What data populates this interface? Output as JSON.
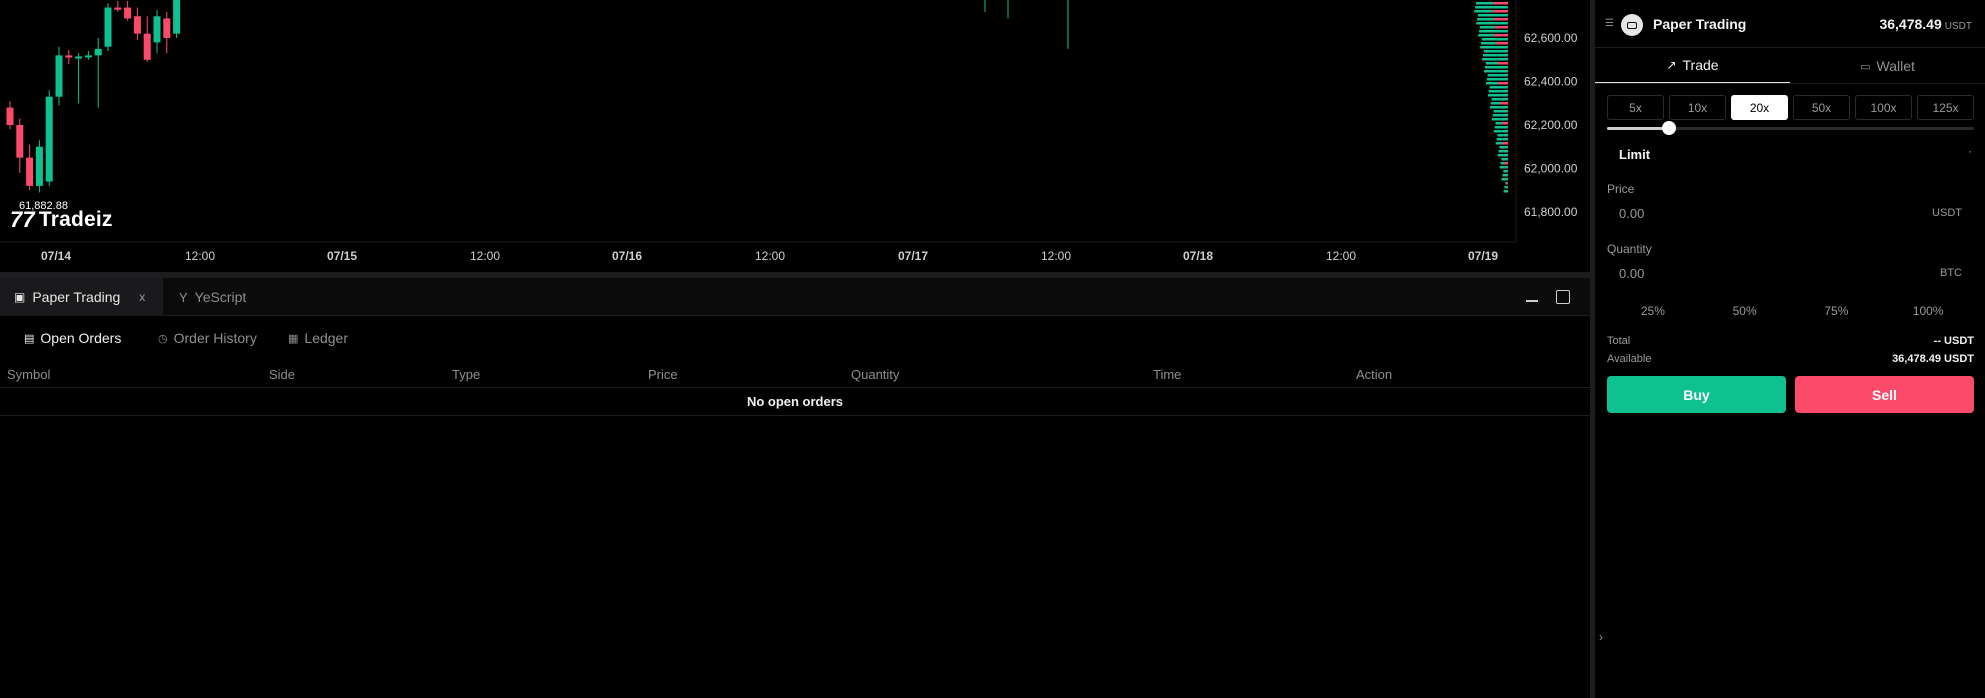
{
  "chart": {
    "type": "candlestick",
    "low_label": "61,882.88",
    "brand": "Tradeiz",
    "x_tick_labels": [
      "07/14",
      "12:00",
      "07/15",
      "12:00",
      "07/16",
      "12:00",
      "07/17",
      "12:00",
      "07/18",
      "12:00",
      "07/19"
    ],
    "y_tick_labels": [
      "62,600.00",
      "62,400.00",
      "62,200.00",
      "62,000.00",
      "61,800.00"
    ],
    "y_ticks": [
      62600,
      62400,
      62200,
      62000,
      61800
    ],
    "colors": {
      "up": "#0fc090",
      "down": "#fb4a6a"
    }
  },
  "chart_data": {
    "type": "candlestick",
    "x_tick_labels": [
      "07/14",
      "12:00",
      "07/15",
      "12:00",
      "07/16",
      "12:00",
      "07/17",
      "12:00",
      "07/18",
      "12:00",
      "07/19"
    ],
    "y_tick_labels": [
      "62,600.00",
      "62,400.00",
      "62,200.00",
      "62,000.00",
      "61,800.00"
    ],
    "annotation": "61,882.88",
    "candles": [
      {
        "o": 62280,
        "h": 62310,
        "l": 62180,
        "c": 62200
      },
      {
        "o": 62200,
        "h": 62230,
        "l": 61980,
        "c": 62050
      },
      {
        "o": 62050,
        "h": 62110,
        "l": 61900,
        "c": 61920
      },
      {
        "o": 61920,
        "h": 62130,
        "l": 61890,
        "c": 62100
      },
      {
        "o": 61940,
        "h": 62360,
        "l": 61920,
        "c": 62330
      },
      {
        "o": 62330,
        "h": 62560,
        "l": 62290,
        "c": 62520
      },
      {
        "o": 62520,
        "h": 62545,
        "l": 62480,
        "c": 62510
      },
      {
        "o": 62510,
        "h": 62530,
        "l": 62300,
        "c": 62515
      },
      {
        "o": 62515,
        "h": 62540,
        "l": 62500,
        "c": 62520
      },
      {
        "o": 62520,
        "h": 62600,
        "l": 62280,
        "c": 62550
      },
      {
        "o": 62560,
        "h": 62760,
        "l": 62540,
        "c": 62740
      },
      {
        "o": 62740,
        "h": 62770,
        "l": 62720,
        "c": 62730
      },
      {
        "o": 62740,
        "h": 62770,
        "l": 62680,
        "c": 62690
      },
      {
        "o": 62700,
        "h": 62740,
        "l": 62590,
        "c": 62620
      },
      {
        "o": 62620,
        "h": 62700,
        "l": 62490,
        "c": 62500
      },
      {
        "o": 62580,
        "h": 62730,
        "l": 62530,
        "c": 62700
      },
      {
        "o": 62690,
        "h": 62720,
        "l": 62530,
        "c": 62600
      },
      {
        "o": 62620,
        "h": 62800,
        "l": 62600,
        "c": 62780
      }
    ],
    "wicks_late": [
      {
        "x": "07/17",
        "h": 62800,
        "l": 62720
      },
      {
        "x": "07/17",
        "h": 62800,
        "l": 62690
      },
      {
        "x": "07/17",
        "h": 62800,
        "l": 62550
      }
    ]
  },
  "bottom_panel": {
    "tabs": [
      {
        "label": "Paper Trading",
        "close": "x"
      },
      {
        "label": "YeScript"
      }
    ],
    "order_tabs": [
      "Open Orders",
      "Order History",
      "Ledger"
    ],
    "columns": [
      "Symbol",
      "Side",
      "Type",
      "Price",
      "Quantity",
      "Time",
      "Action"
    ],
    "empty_message": "No open orders"
  },
  "trade_panel": {
    "title": "Paper Trading",
    "balance": "36,478.49",
    "balance_unit": "USDT",
    "tabs": [
      "Trade",
      "Wallet"
    ],
    "leverage_options": [
      "5x",
      "10x",
      "20x",
      "50x",
      "100x",
      "125x"
    ],
    "leverage_selected": "20x",
    "leverage_slider_fraction": 0.17,
    "order_type": "Limit",
    "price_label": "Price",
    "price_value": "0.00",
    "price_unit": "USDT",
    "quantity_label": "Quantity",
    "quantity_value": "0.00",
    "quantity_unit": "BTC",
    "percentages": [
      "25%",
      "50%",
      "75%",
      "100%"
    ],
    "total_label": "Total",
    "total_value": "-- USDT",
    "available_label": "Available",
    "available_value": "36,478.49 USDT",
    "buy_label": "Buy",
    "sell_label": "Sell"
  }
}
